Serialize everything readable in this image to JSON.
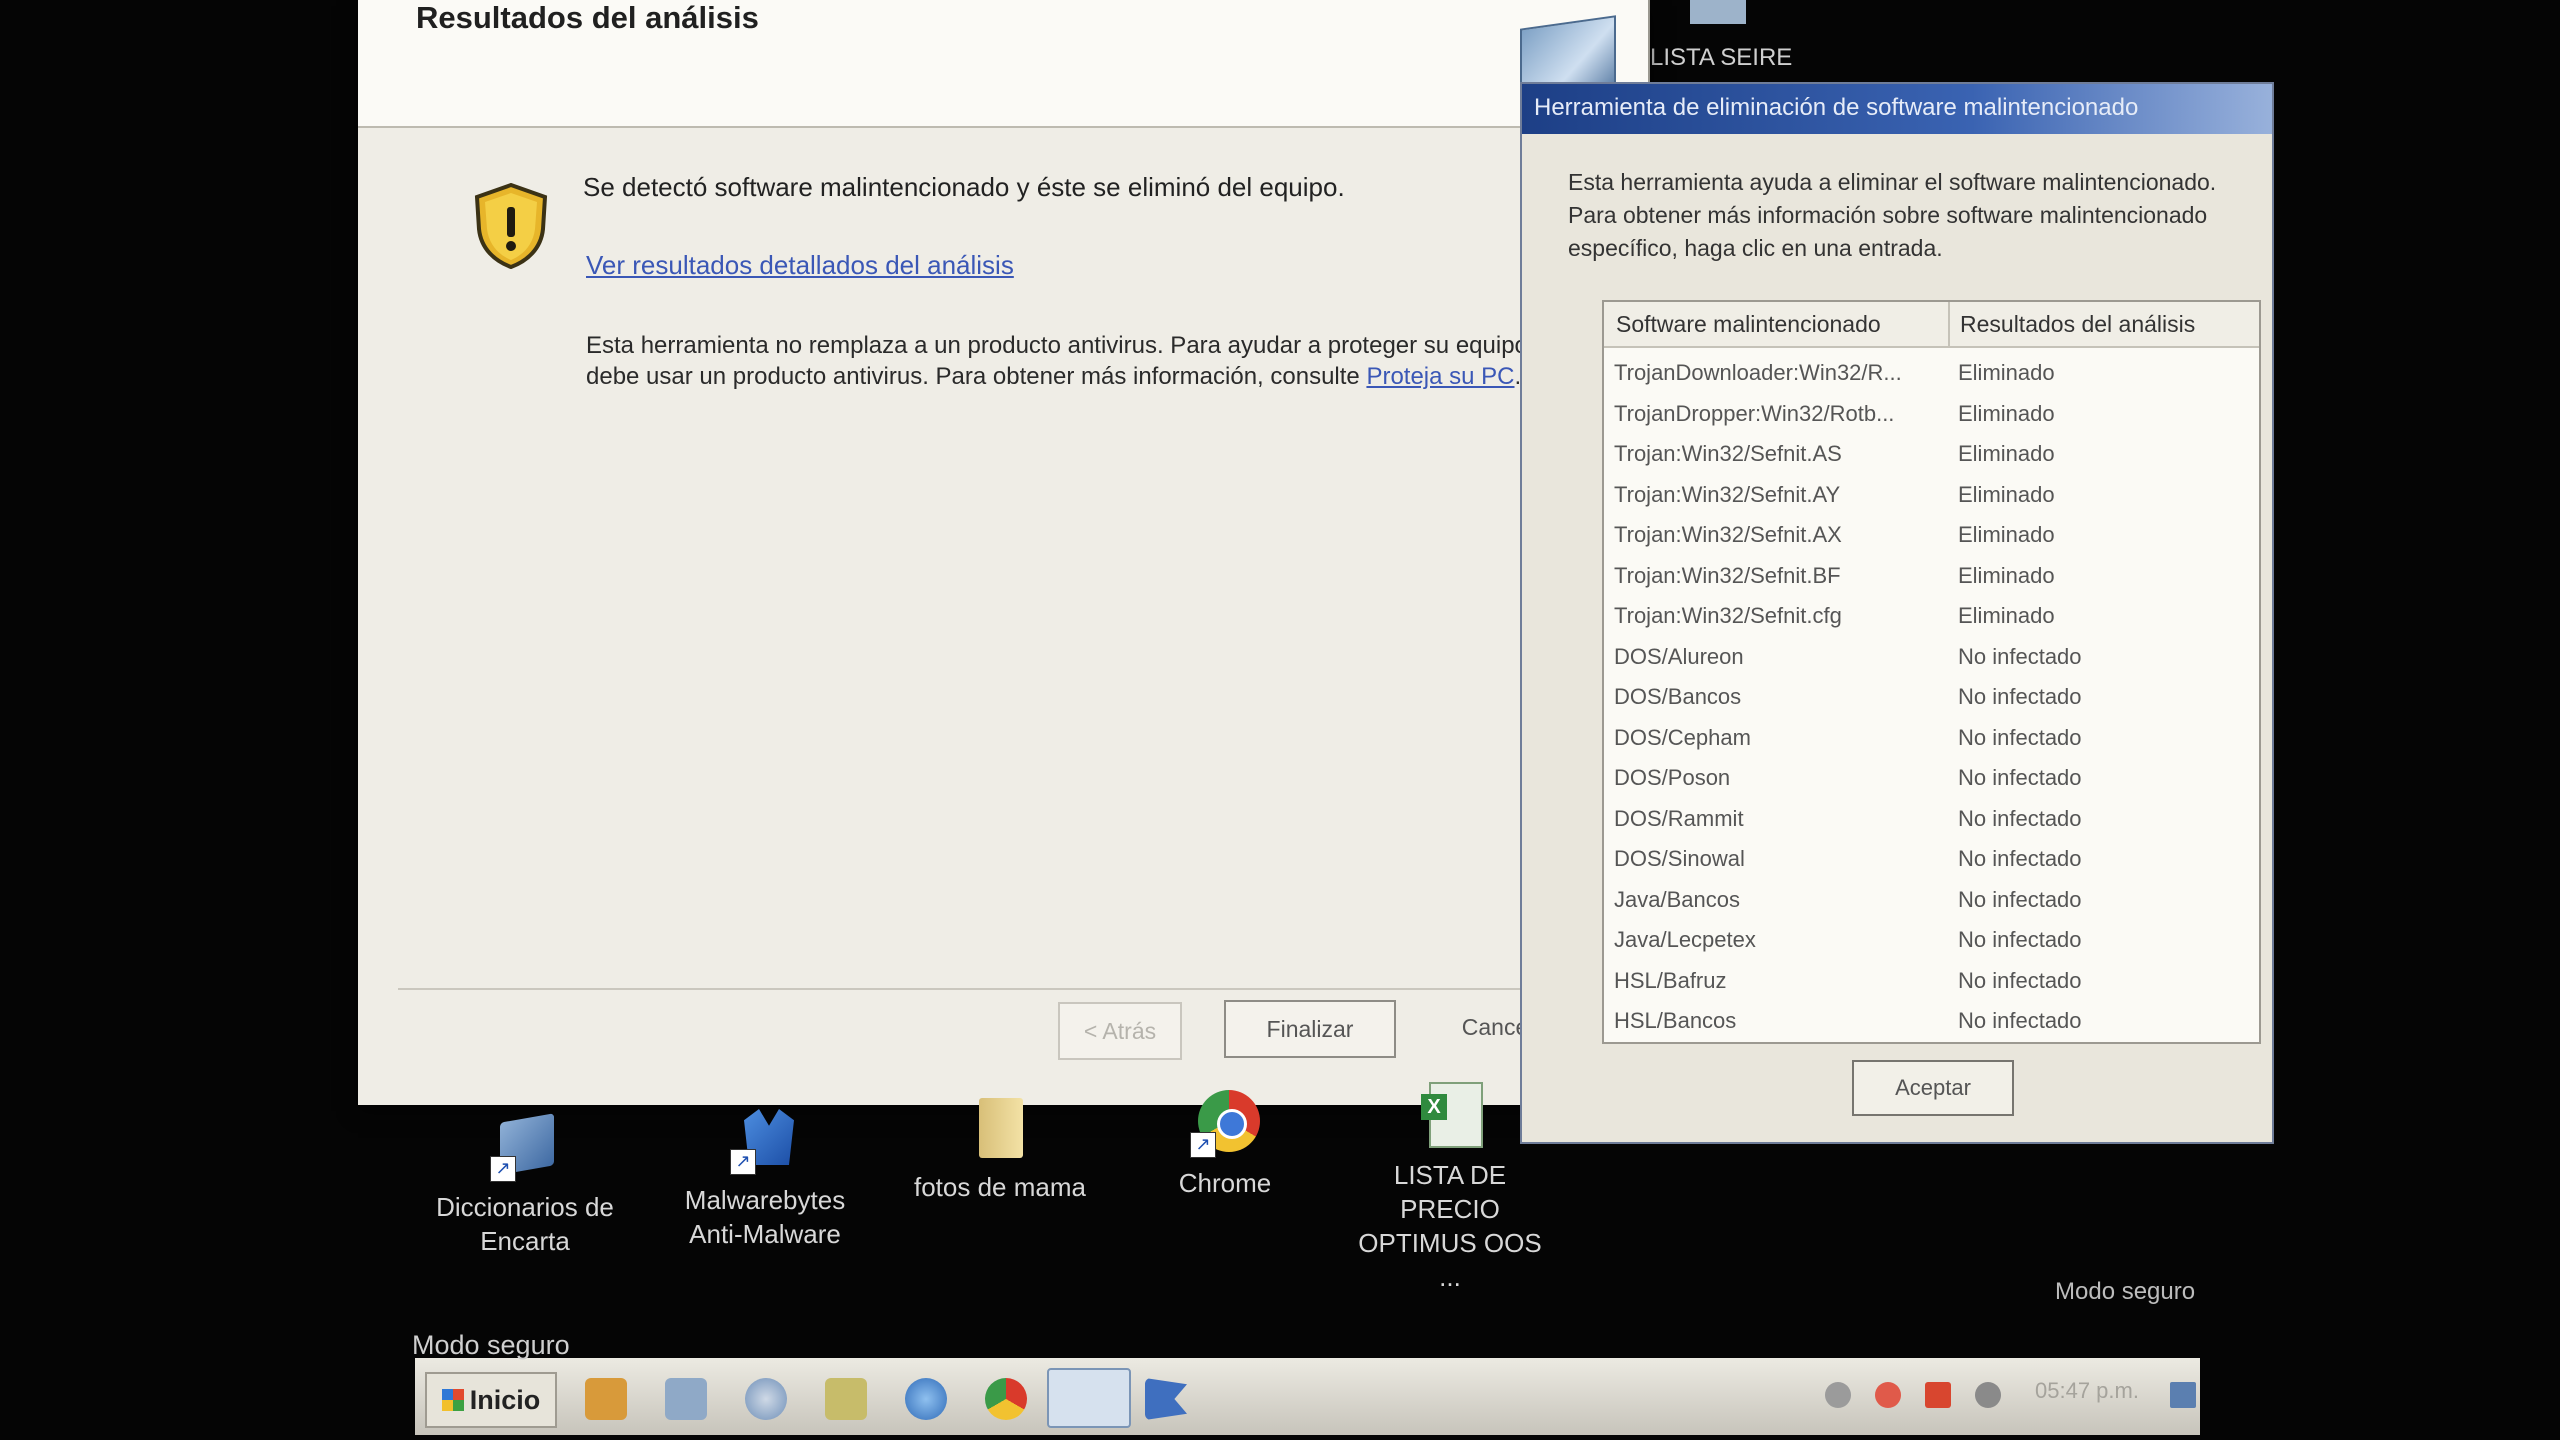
{
  "wizard": {
    "title": "Resultados del análisis",
    "detected_message": "Se detectó software malintencionado y éste se eliminó del equipo.",
    "details_link": "Ver resultados detallados del análisis",
    "disclaimer_text": "Esta herramienta no remplaza a un producto antivirus. Para ayudar a proteger su equipo, debe usar un producto antivirus. Para obtener más información, consulte",
    "protect_link": "Proteja su PC",
    "buttons": {
      "back": "< Atrás",
      "finish": "Finalizar",
      "cancel": "Cance"
    }
  },
  "background": {
    "top_desktop_label": "LISTA SEIRE"
  },
  "results_window": {
    "title": "Herramienta de eliminación de software malintencionado",
    "description": "Esta herramienta ayuda a eliminar el software malintencionado. Para obtener más información sobre software malintencionado específico, haga clic en una entrada.",
    "columns": [
      "Software malintencionado",
      "Resultados del análisis"
    ],
    "rows": [
      [
        "TrojanDownloader:Win32/R...",
        "Eliminado"
      ],
      [
        "TrojanDropper:Win32/Rotb...",
        "Eliminado"
      ],
      [
        "Trojan:Win32/Sefnit.AS",
        "Eliminado"
      ],
      [
        "Trojan:Win32/Sefnit.AY",
        "Eliminado"
      ],
      [
        "Trojan:Win32/Sefnit.AX",
        "Eliminado"
      ],
      [
        "Trojan:Win32/Sefnit.BF",
        "Eliminado"
      ],
      [
        "Trojan:Win32/Sefnit.cfg",
        "Eliminado"
      ],
      [
        "DOS/Alureon",
        "No infectado"
      ],
      [
        "DOS/Bancos",
        "No infectado"
      ],
      [
        "DOS/Cepham",
        "No infectado"
      ],
      [
        "DOS/Poson",
        "No infectado"
      ],
      [
        "DOS/Rammit",
        "No infectado"
      ],
      [
        "DOS/Sinowal",
        "No infectado"
      ],
      [
        "Java/Bancos",
        "No infectado"
      ],
      [
        "Java/Lecpetex",
        "No infectado"
      ],
      [
        "HSL/Bafruz",
        "No infectado"
      ],
      [
        "HSL/Bancos",
        "No infectado"
      ]
    ],
    "accept_button": "Aceptar"
  },
  "desktop_icons": [
    {
      "line1": "Diccionarios de",
      "line2": "Encarta"
    },
    {
      "line1": "Malwarebytes",
      "line2": "Anti-Malware"
    },
    {
      "line1": "fotos de mama",
      "line2": ""
    },
    {
      "line1": "Chrome",
      "line2": ""
    },
    {
      "line1": "LISTA DE PRECIO",
      "line2": "OPTIMUS OOS ..."
    }
  ],
  "taskbar": {
    "safe_mode_left": "Modo seguro",
    "safe_mode_right": "Modo seguro",
    "start_label": "Inicio",
    "clock": "05:47 p.m."
  },
  "colors": {
    "link": "#3a57b6",
    "titlebar": "#1d3f86"
  }
}
